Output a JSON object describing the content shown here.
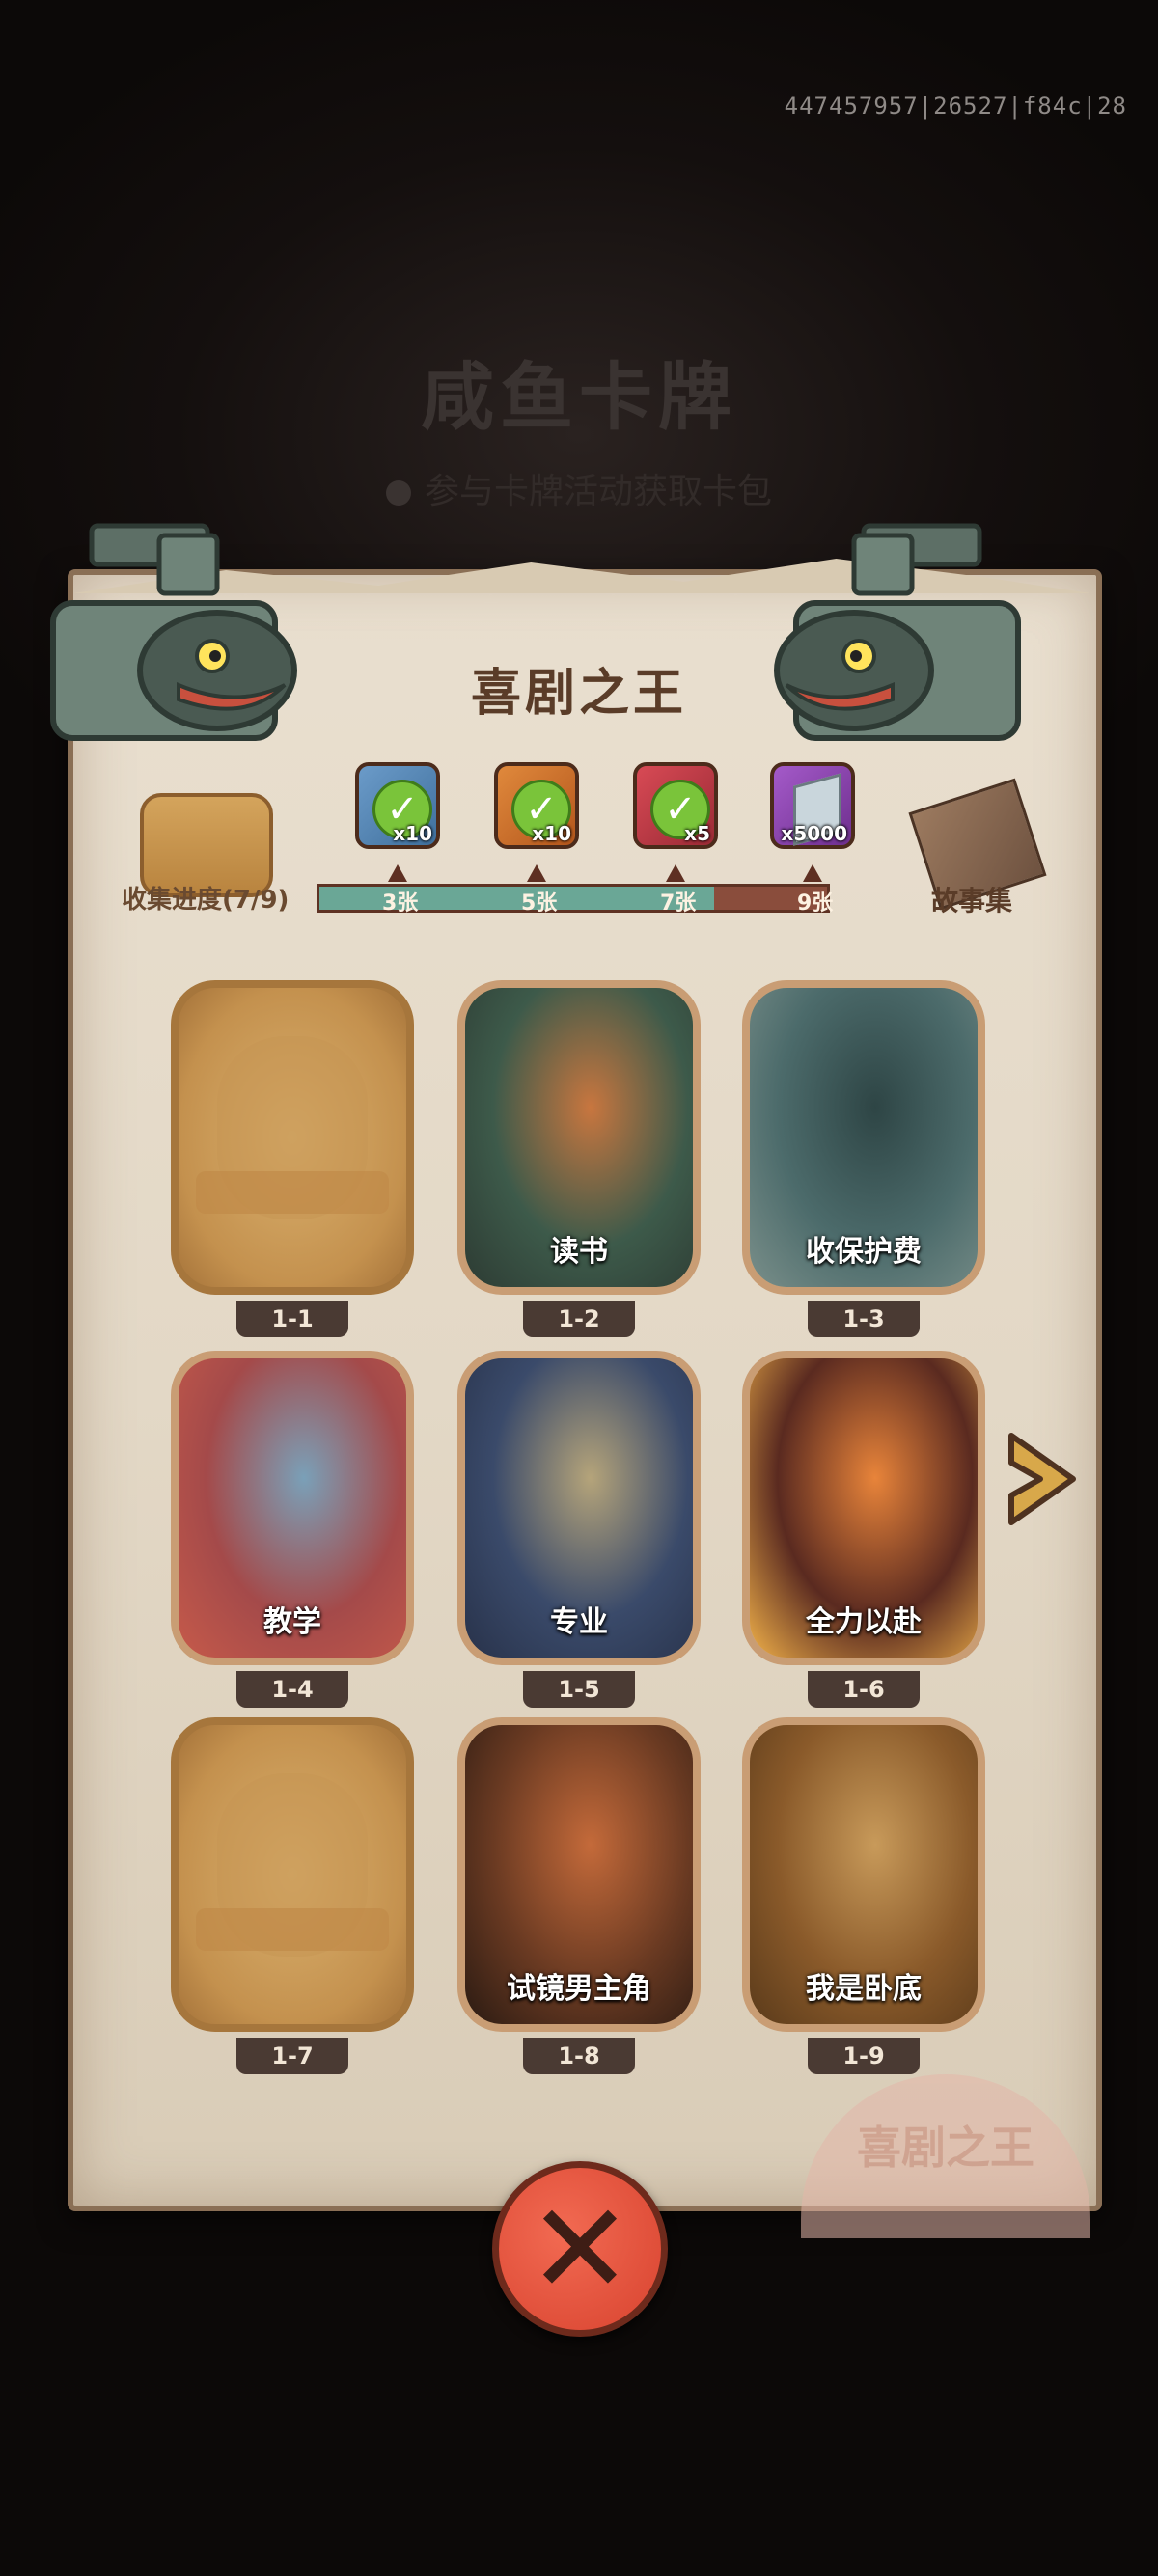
{
  "header": {
    "uid_text": "447457957|26527|f84c|28",
    "bg_title": "咸鱼卡牌",
    "bg_subtitle": "参与卡牌活动获取卡包"
  },
  "panel": {
    "title": "喜剧之王",
    "stamp_text": "喜剧之王"
  },
  "progress": {
    "label": "收集进度(7/9)",
    "collected": 7,
    "total": 9,
    "milestones": [
      {
        "label": "3张",
        "reward_qty": "x10",
        "reward_icon": "green-item-icon",
        "claimed": true
      },
      {
        "label": "5张",
        "reward_qty": "x10",
        "reward_icon": "orange-item-icon",
        "claimed": true
      },
      {
        "label": "7张",
        "reward_qty": "x5",
        "reward_icon": "gem-orb-icon",
        "claimed": true
      },
      {
        "label": "9张",
        "reward_qty": "x5000",
        "reward_icon": "crystal-icon",
        "claimed": false
      }
    ]
  },
  "story": {
    "label": "故事集"
  },
  "cards": [
    {
      "id": "1-1",
      "name": "",
      "locked": true
    },
    {
      "id": "1-2",
      "name": "读书",
      "locked": false
    },
    {
      "id": "1-3",
      "name": "收保护费",
      "locked": false
    },
    {
      "id": "1-4",
      "name": "教学",
      "locked": false
    },
    {
      "id": "1-5",
      "name": "专业",
      "locked": false
    },
    {
      "id": "1-6",
      "name": "全力以赴",
      "locked": false
    },
    {
      "id": "1-7",
      "name": "",
      "locked": true
    },
    {
      "id": "1-8",
      "name": "试镜男主角",
      "locked": false
    },
    {
      "id": "1-9",
      "name": "我是卧底",
      "locked": false
    }
  ],
  "colors": {
    "bar_filled": "#6aa796",
    "bar_empty": "#8a4d3c",
    "close_button": "#e34f3a"
  }
}
